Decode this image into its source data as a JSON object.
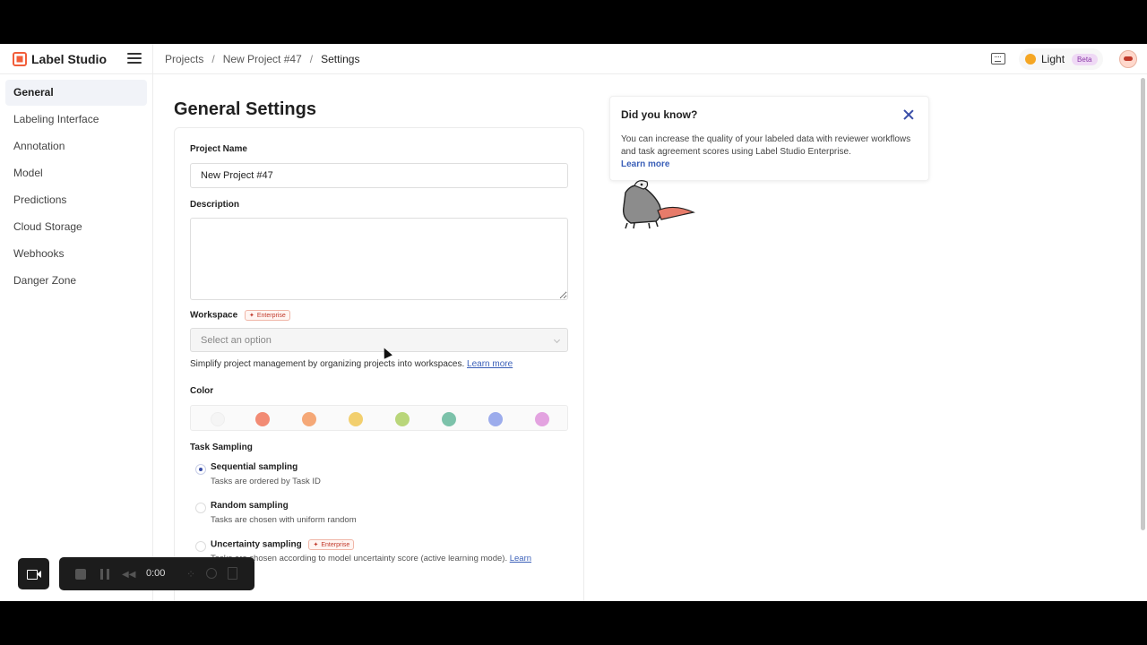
{
  "app": {
    "name": "Label Studio"
  },
  "breadcrumb": [
    "Projects",
    "/",
    "New Project #47",
    "/",
    "Settings"
  ],
  "header": {
    "theme_label": "Light",
    "beta_label": "Beta"
  },
  "sidebar": {
    "items": [
      {
        "label": "General",
        "active": true
      },
      {
        "label": "Labeling Interface"
      },
      {
        "label": "Annotation"
      },
      {
        "label": "Model"
      },
      {
        "label": "Predictions"
      },
      {
        "label": "Cloud Storage"
      },
      {
        "label": "Webhooks"
      },
      {
        "label": "Danger Zone"
      }
    ]
  },
  "main": {
    "title": "General Settings",
    "project_name_label": "Project Name",
    "project_name_value": "New Project #47",
    "description_label": "Description",
    "description_value": "",
    "workspace_label": "Workspace",
    "enterprise_badge": "Enterprise",
    "workspace_placeholder": "Select an option",
    "workspace_help": "Simplify project management by organizing projects into workspaces.",
    "learn_more": "Learn more",
    "color_label": "Color",
    "colors": [
      "#f5f5f5",
      "#f28b74",
      "#f5a877",
      "#f2cf6e",
      "#b9d67a",
      "#7cc2aa",
      "#9cacec",
      "#e3a3e0"
    ],
    "task_sampling_label": "Task Sampling",
    "sampling": [
      {
        "title": "Sequential sampling",
        "desc": "Tasks are ordered by Task ID",
        "checked": true
      },
      {
        "title": "Random sampling",
        "desc": "Tasks are chosen with uniform random",
        "checked": false
      },
      {
        "title": "Uncertainty sampling",
        "desc": "Tasks are chosen according to model uncertainty score (active learning mode).",
        "checked": false,
        "enterprise": true
      }
    ],
    "learn_short": "Learn"
  },
  "tip": {
    "title": "Did you know?",
    "body": "You can increase the quality of your labeled data with reviewer workflows and task agreement scores using Label Studio Enterprise.",
    "link": "Learn more"
  },
  "recorder": {
    "time": "0:00"
  }
}
